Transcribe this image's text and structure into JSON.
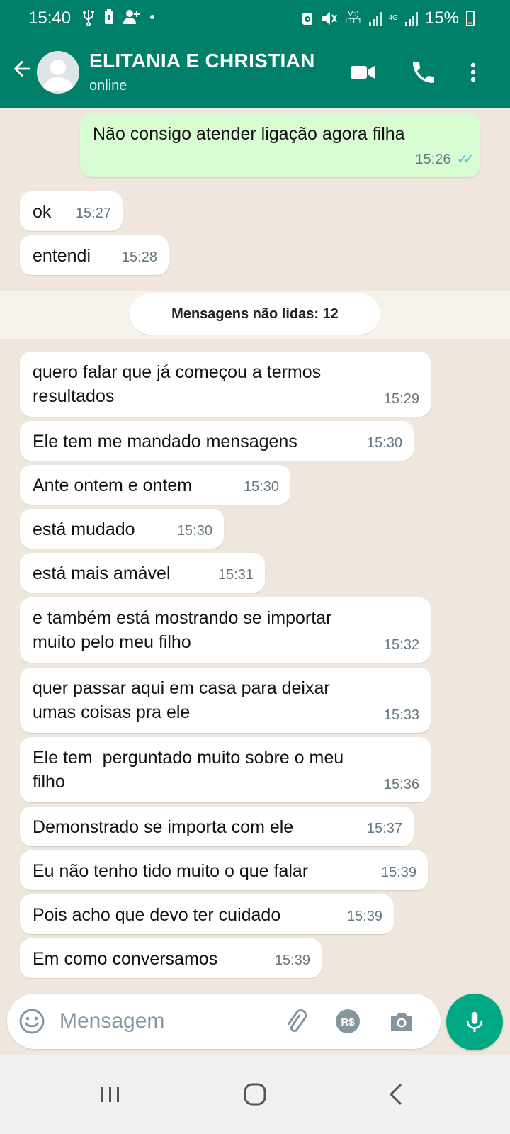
{
  "status_bar": {
    "time": "15:40",
    "battery": "15%",
    "net_volte": "Vo)\nLTE1",
    "net_4g": "4G"
  },
  "header": {
    "contact_name": "ELITANIA E CHRISTIAN",
    "contact_status": "online"
  },
  "messages": [
    {
      "text": "Não consigo atender ligação agora filha",
      "time": "15:26",
      "direction": "out",
      "read": true
    },
    {
      "text": "ok",
      "time": "15:27",
      "direction": "in"
    },
    {
      "text": "entendi",
      "time": "15:28",
      "direction": "in"
    },
    {
      "text": "quero falar que já começou a termos\nresultados",
      "time": "15:29",
      "direction": "in"
    },
    {
      "text": "Ele tem me mandado mensagens",
      "time": "15:30",
      "direction": "in"
    },
    {
      "text": "Ante ontem e ontem",
      "time": "15:30",
      "direction": "in"
    },
    {
      "text": "está mudado",
      "time": "15:30",
      "direction": "in"
    },
    {
      "text": "está mais amável",
      "time": "15:31",
      "direction": "in"
    },
    {
      "text": "e também está mostrando se importar\nmuito pelo meu filho",
      "time": "15:32",
      "direction": "in"
    },
    {
      "text": "quer passar aqui em casa para deixar\numas coisas pra ele",
      "time": "15:33",
      "direction": "in"
    },
    {
      "text": "Ele tem  perguntado muito sobre o meu\nfilho",
      "time": "15:36",
      "direction": "in"
    },
    {
      "text": "Demonstrado se importa com ele",
      "time": "15:37",
      "direction": "in"
    },
    {
      "text": "Eu não tenho tido muito o que falar",
      "time": "15:39",
      "direction": "in"
    },
    {
      "text": "Pois acho que devo ter cuidado",
      "time": "15:39",
      "direction": "in"
    },
    {
      "text": "Em como conversamos",
      "time": "15:39",
      "direction": "in"
    }
  ],
  "unread_banner": "Mensagens não lidas: 12",
  "input": {
    "placeholder": "Mensagem"
  },
  "colors": {
    "header": "#008069",
    "outgoing_bubble": "#d9fdd3",
    "incoming_bubble": "#ffffff",
    "chat_background": "#efe7dd",
    "mic_button": "#00a884",
    "read_ticks": "#53bdeb"
  },
  "icons": {
    "header": [
      "back-arrow-icon",
      "avatar",
      "video-call-icon",
      "phone-icon",
      "more-vert-icon"
    ],
    "input": [
      "emoji-icon",
      "attach-icon",
      "payment-icon",
      "camera-icon",
      "mic-icon"
    ],
    "nav": [
      "recents-icon",
      "home-icon",
      "back-icon"
    ]
  }
}
